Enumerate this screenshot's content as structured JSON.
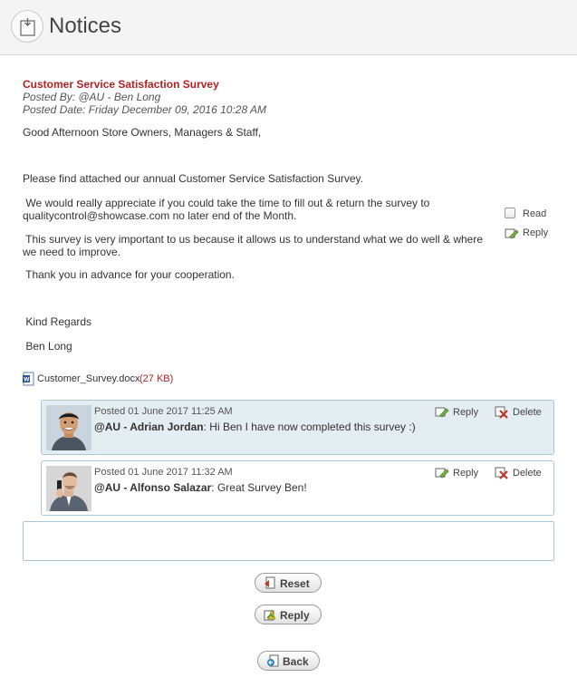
{
  "header": {
    "title": "Notices",
    "icon": "notice-board-icon"
  },
  "notice": {
    "title": "Customer Service Satisfaction Survey",
    "posted_by": "Posted By: @AU - Ben Long",
    "posted_date": "Posted Date: Friday December 09, 2016 10:28 AM",
    "greeting": "Good Afternoon Store Owners, Managers & Staff,",
    "p1": "Please find attached our annual Customer Service Satisfaction Survey.",
    "p2_line1": " We would really appreciate if you could take the time to fill out & return the survey to",
    "p2_line2": "qualitycontrol@showcase.com no later end of the Month.",
    "p3_line1": " This survey is very important to us because it allows us to understand what we do well & where",
    "p3_line2": "we need to improve.",
    "p4": " Thank you in advance for your cooperation.",
    "signoff": " Kind Regards",
    "signature": " Ben Long",
    "read_label": "Read",
    "reply_label": "Reply"
  },
  "attachment": {
    "name": "Customer_Survey.docx",
    "size": "(27 KB)",
    "icon": "word-document-icon"
  },
  "comments": [
    {
      "posted": "Posted 01 June 2017 11:25 AM",
      "author": "@AU - Adrian Jordan",
      "message": ": Hi Ben I have now completed this survey :)",
      "reply_label": "Reply",
      "delete_label": "Delete"
    },
    {
      "posted": "Posted 01 June 2017 11:32 AM",
      "author": "@AU - Alfonso Salazar",
      "message": ": Great Survey Ben!",
      "reply_label": "Reply",
      "delete_label": "Delete"
    }
  ],
  "reply_box": {
    "value": ""
  },
  "buttons": {
    "reset": "Reset",
    "reply": "Reply",
    "back": "Back"
  },
  "colors": {
    "title_red": "#b22222",
    "comment_bg": "#e3edf2",
    "comment_border": "#a8c8d8"
  }
}
